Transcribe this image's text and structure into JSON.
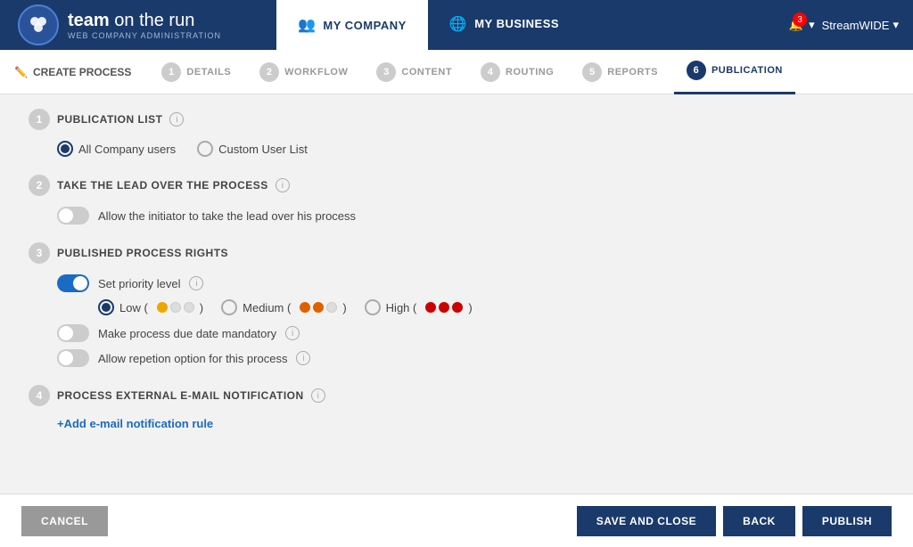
{
  "header": {
    "logo_team": "team",
    "logo_on_the_run": " on the run",
    "logo_subtitle": "WEB COMPANY ADMINISTRATION",
    "nav_my_company": "MY COMPANY",
    "nav_my_business": "MY BUSINESS",
    "notification_count": "3",
    "user_name": "StreamWIDE",
    "chevron": "▾",
    "bell": "🔔"
  },
  "steps_bar": {
    "create_process_label": "CREATE PROCESS",
    "steps": [
      {
        "num": "1",
        "label": "DETAILS"
      },
      {
        "num": "2",
        "label": "WORKFLOW"
      },
      {
        "num": "3",
        "label": "CONTENT"
      },
      {
        "num": "4",
        "label": "ROUTING"
      },
      {
        "num": "5",
        "label": "REPORTS"
      },
      {
        "num": "6",
        "label": "PUBLICATION"
      }
    ]
  },
  "sections": {
    "s1_num": "1",
    "s1_title": "PUBLICATION LIST",
    "s1_radio1": "All Company users",
    "s1_radio2": "Custom User List",
    "s2_num": "2",
    "s2_title": "TAKE THE LEAD OVER THE PROCESS",
    "s2_toggle_label": "Allow the initiator to take the lead over his process",
    "s3_num": "3",
    "s3_title": "PUBLISHED PROCESS RIGHTS",
    "s3_toggle1_label": "Set priority level",
    "priority_low": "Low (",
    "priority_low_close": ")",
    "priority_medium": "Medium (",
    "priority_medium_close": ")",
    "priority_high": "High (",
    "priority_high_close": ")",
    "s3_toggle2_label": "Make process due date mandatory",
    "s3_toggle3_label": "Allow repetion option for this process",
    "s4_num": "4",
    "s4_title": "PROCESS EXTERNAL E-MAIL NOTIFICATION",
    "s4_add_link": "+Add e-mail notification rule"
  },
  "footer": {
    "cancel_label": "CANCEL",
    "save_label": "SAVE AND CLOSE",
    "back_label": "BACK",
    "publish_label": "PUBLISH"
  }
}
